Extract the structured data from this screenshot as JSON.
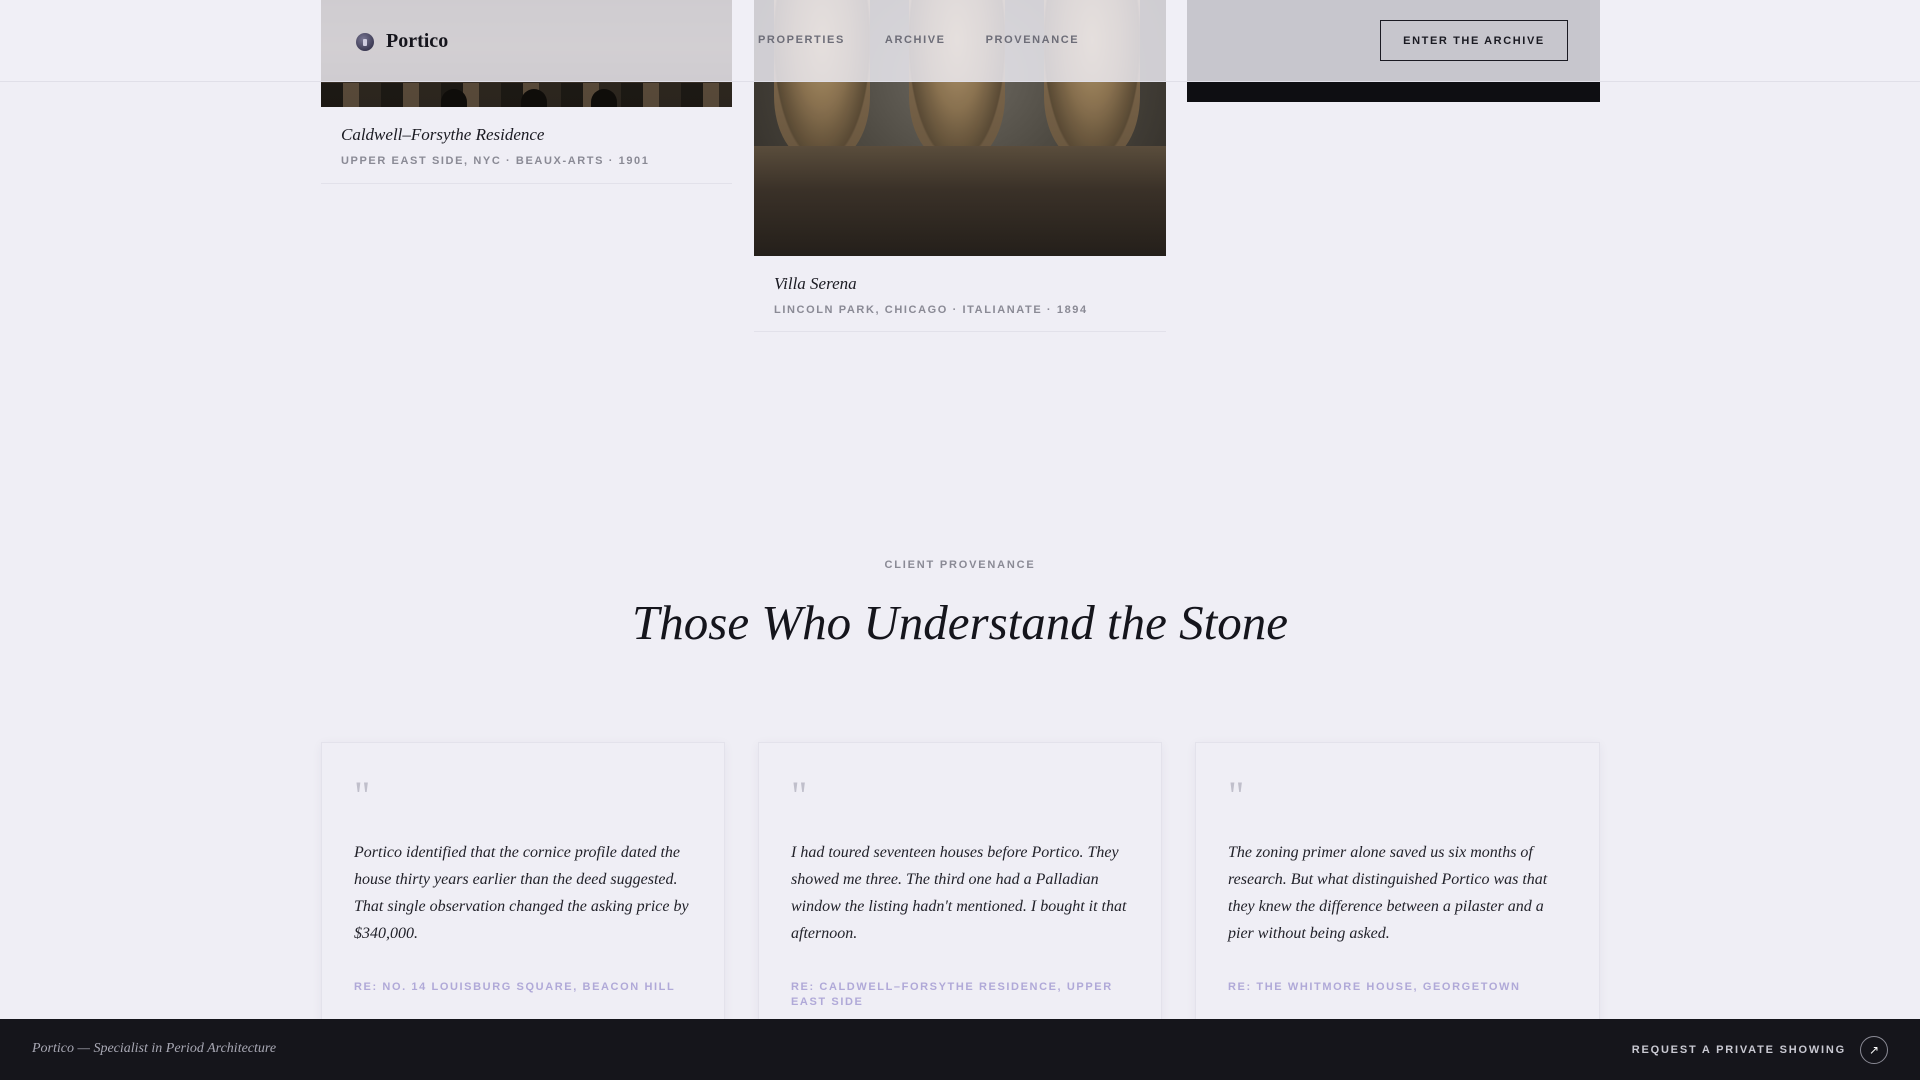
{
  "header": {
    "brand": "Portico",
    "nav": [
      "PROPERTIES",
      "ARCHIVE",
      "PROVENANCE"
    ],
    "cta": "ENTER THE ARCHIVE"
  },
  "properties": [
    {
      "title": "Caldwell–Forsythe Residence",
      "meta": "UPPER EAST SIDE, NYC · BEAUX-ARTS · 1901"
    },
    {
      "title": "Villa Serena",
      "meta": "LINCOLN PARK, CHICAGO · ITALIANATE · 1894"
    }
  ],
  "provenance": {
    "eyebrow": "CLIENT PROVENANCE",
    "title": "Those Who Understand the Stone",
    "testimonials": [
      {
        "quote_mark": "\"",
        "text": "Portico identified that the cornice profile dated the house thirty years earlier than the deed suggested. That single observation changed the asking price by $340,000.",
        "ref": "RE: NO. 14 LOUISBURG SQUARE, BEACON HILL"
      },
      {
        "quote_mark": "\"",
        "text": "I had toured seventeen houses before Portico. They showed me three. The third one had a Palladian window the listing hadn't mentioned. I bought it that afternoon.",
        "ref": "RE: CALDWELL–FORSYTHE RESIDENCE, UPPER EAST SIDE"
      },
      {
        "quote_mark": "\"",
        "text": "The zoning primer alone saved us six months of research. But what distinguished Portico was that they knew the difference between a pilaster and a pier without being asked.",
        "ref": "RE: THE WHITMORE HOUSE, GEORGETOWN"
      }
    ]
  },
  "footer": {
    "tagline": "Portico — Specialist in Period Architecture",
    "cta": "REQUEST A PRIVATE SHOWING",
    "cta_icon": "arrow-up-right-icon"
  }
}
